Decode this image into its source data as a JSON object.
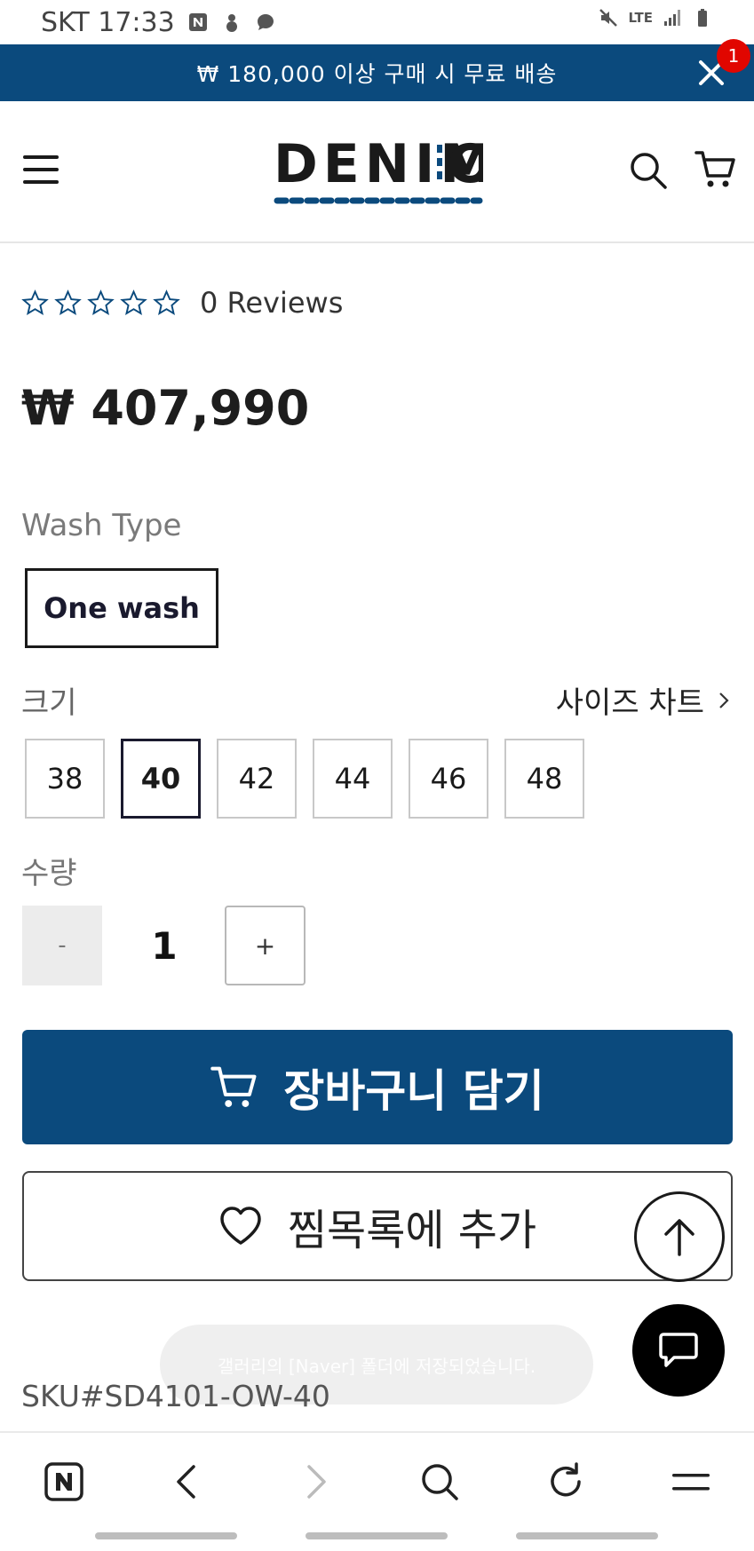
{
  "status_bar": {
    "carrier_time": "SKT 17:33",
    "network": "LTE"
  },
  "promo": {
    "text": "₩ 180,000 이상 구매 시 무료 배송"
  },
  "header": {
    "logo_text": "DENIM:O",
    "cart_count": "1"
  },
  "product": {
    "rating_stars": 0,
    "reviews_text": "0 Reviews",
    "price": "₩ 407,990",
    "wash_type_label": "Wash Type",
    "wash_option": "One wash",
    "size_label": "크기",
    "size_chart_link": "사이즈 차트",
    "sizes": [
      "38",
      "40",
      "42",
      "44",
      "46",
      "48"
    ],
    "selected_size": "40",
    "quantity_label": "수량",
    "quantity_minus": "-",
    "quantity_value": "1",
    "quantity_plus": "+",
    "add_to_cart": "장바구니 담기",
    "add_to_wishlist": "찜목록에 추가",
    "sku": "SKU#SD4101-OW-40"
  },
  "toast": {
    "text": "갤러리의 [Naver] 폴더에 저장되었습니다."
  },
  "colors": {
    "brand_blue": "#0b4a7d",
    "badge_red": "#e10600",
    "logo_dots": "#0b4a7d"
  }
}
